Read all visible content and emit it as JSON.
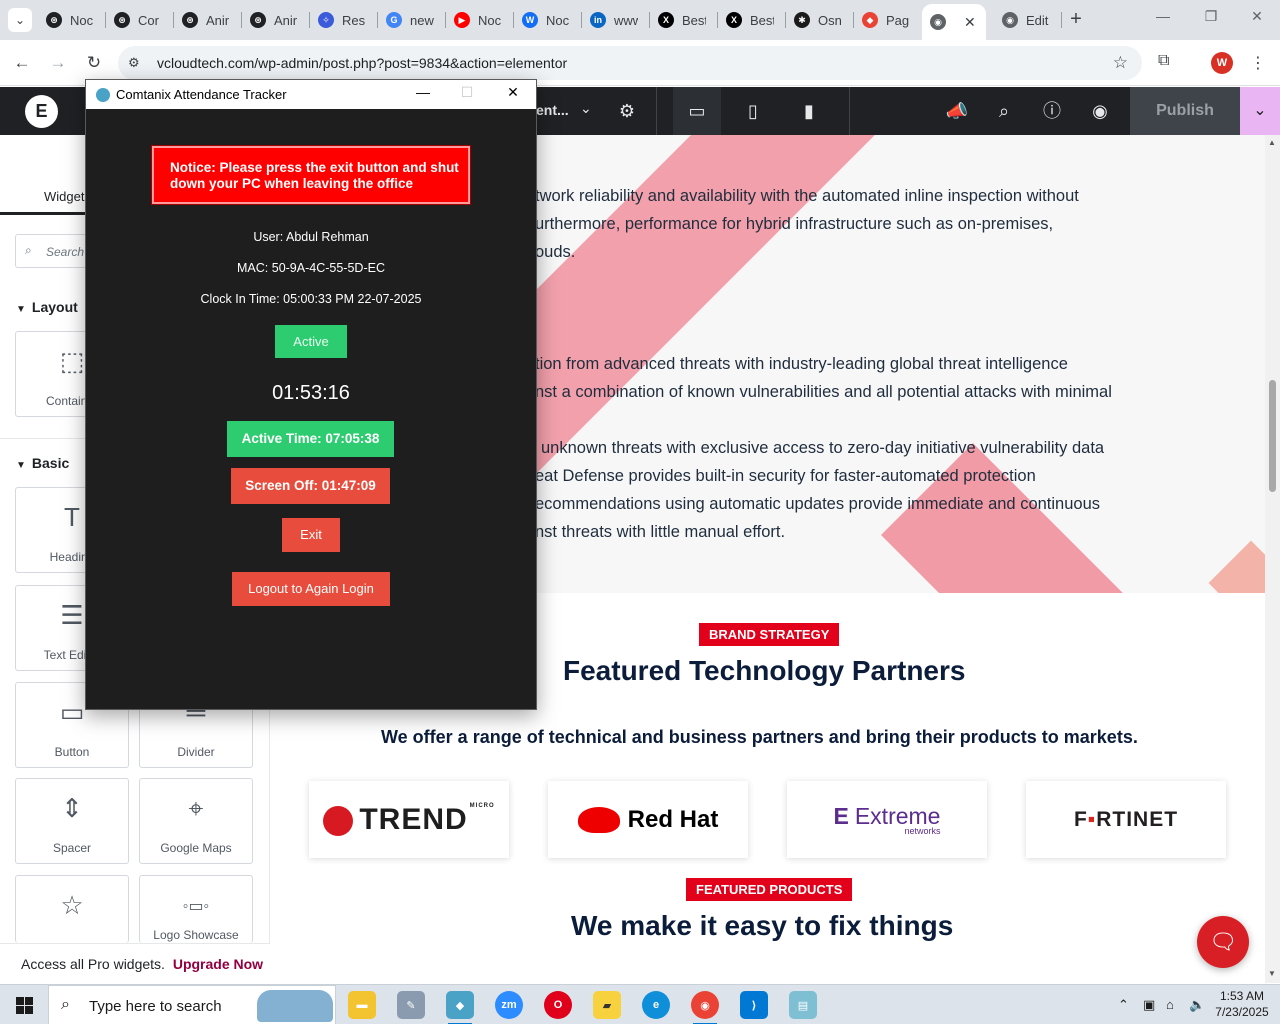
{
  "browser": {
    "tabs": [
      {
        "label": "Noc",
        "fav": "openai-icon",
        "color": "#202124",
        "glyph": "⊛"
      },
      {
        "label": "Cor",
        "fav": "openai-icon",
        "color": "#202124",
        "glyph": "⊛"
      },
      {
        "label": "Anir",
        "fav": "openai-icon",
        "color": "#202124",
        "glyph": "⊛"
      },
      {
        "label": "Anir",
        "fav": "openai-icon",
        "color": "#202124",
        "glyph": "⊛"
      },
      {
        "label": "Resp",
        "fav": "copilot-icon",
        "color": "#3b5bdb",
        "glyph": "✧"
      },
      {
        "label": "new",
        "fav": "google-icon",
        "color": "#4285f4",
        "glyph": "G"
      },
      {
        "label": "Noc",
        "fav": "youtube-icon",
        "color": "#ff0000",
        "glyph": "▶"
      },
      {
        "label": "Noc",
        "fav": "webflow-icon",
        "color": "#146ef5",
        "glyph": "W"
      },
      {
        "label": "www",
        "fav": "linkedin-icon",
        "color": "#0a66c2",
        "glyph": "in"
      },
      {
        "label": "Best",
        "fav": "x-icon",
        "color": "#000000",
        "glyph": "X"
      },
      {
        "label": "Best",
        "fav": "x-icon",
        "color": "#000000",
        "glyph": "X"
      },
      {
        "label": "Osn",
        "fav": "perplexity-icon",
        "color": "#1b1b1b",
        "glyph": "✱"
      },
      {
        "label": "Pag",
        "fav": "pagespeed-icon",
        "color": "#ea4335",
        "glyph": "◆"
      },
      {
        "label": "",
        "fav": "globe-icon",
        "color": "#5f6368",
        "glyph": "◉",
        "active": true
      },
      {
        "label": "Edit",
        "fav": "globe-icon",
        "color": "#5f6368",
        "glyph": "◉"
      }
    ],
    "url": "vcloudtech.com/wp-admin/post.php?post=9834&action=elementor",
    "profile_initial": "W"
  },
  "elementor": {
    "document_title": "ent...",
    "publish_label": "Publish",
    "tab_widgets": "Widgets",
    "search_placeholder": "Search Widget...",
    "cat_layout": "Layout",
    "cat_basic": "Basic",
    "widgets": {
      "container": "Container",
      "heading": "Heading",
      "text_editor": "Text Editor",
      "button": "Button",
      "divider": "Divider",
      "spacer": "Spacer",
      "google_maps": "Google Maps",
      "logo_showcase": "Logo Showcase"
    },
    "footer_text": "Access all Pro widgets.",
    "upgrade_label": "Upgrade Now"
  },
  "page": {
    "hero_lines": [
      "twork reliability and availability with the automated inline inspection without",
      "urthermore,  performance for hybrid infrastructure such as on-premises,",
      "ouds.",
      "tion from advanced threats with industry-leading global threat intelligence",
      "nst a combination of known vulnerabilities and all potential attacks with minimal",
      "unknown threats with exclusive access to zero-day initiative vulnerability data",
      "eat Defense provides built-in security for faster-automated protection",
      "ecommendations using automatic updates provide immediate and continuous",
      "nst threats with little manual effort."
    ],
    "badge_brand": "BRAND STRATEGY",
    "partners_title": "Featured Technology Partners",
    "partners_sub": "We offer a range of technical and business partners and bring their products to markets.",
    "partners": {
      "trend": "TREND",
      "trend_small": "MICRO",
      "redhat": "Red Hat",
      "extreme": "Extreme",
      "extreme_small": "networks",
      "fortinet_a": "F",
      "fortinet_b": "▪",
      "fortinet_c": "RTINET"
    },
    "badge_products": "FEATURED PRODUCTS",
    "products_title": "We make it easy to fix things"
  },
  "tracker": {
    "window_title": "Comtanix Attendance Tracker",
    "notice": "Notice: Please press the exit button and shut down your PC when leaving the office",
    "user": "User: Abdul Rehman",
    "mac": "MAC: 50-9A-4C-55-5D-EC",
    "clock_in": "Clock In Time: 05:00:33 PM 22-07-2025",
    "status": "Active",
    "timer": "01:53:16",
    "active_time": "Active Time: 07:05:38",
    "screen_off": "Screen Off: 01:47:09",
    "exit_label": "Exit",
    "logout_label": "Logout to Again Login"
  },
  "taskbar": {
    "search_placeholder": "Type here to search",
    "time": "1:53 AM",
    "date": "7/23/2025",
    "zoom_label": "zm"
  }
}
